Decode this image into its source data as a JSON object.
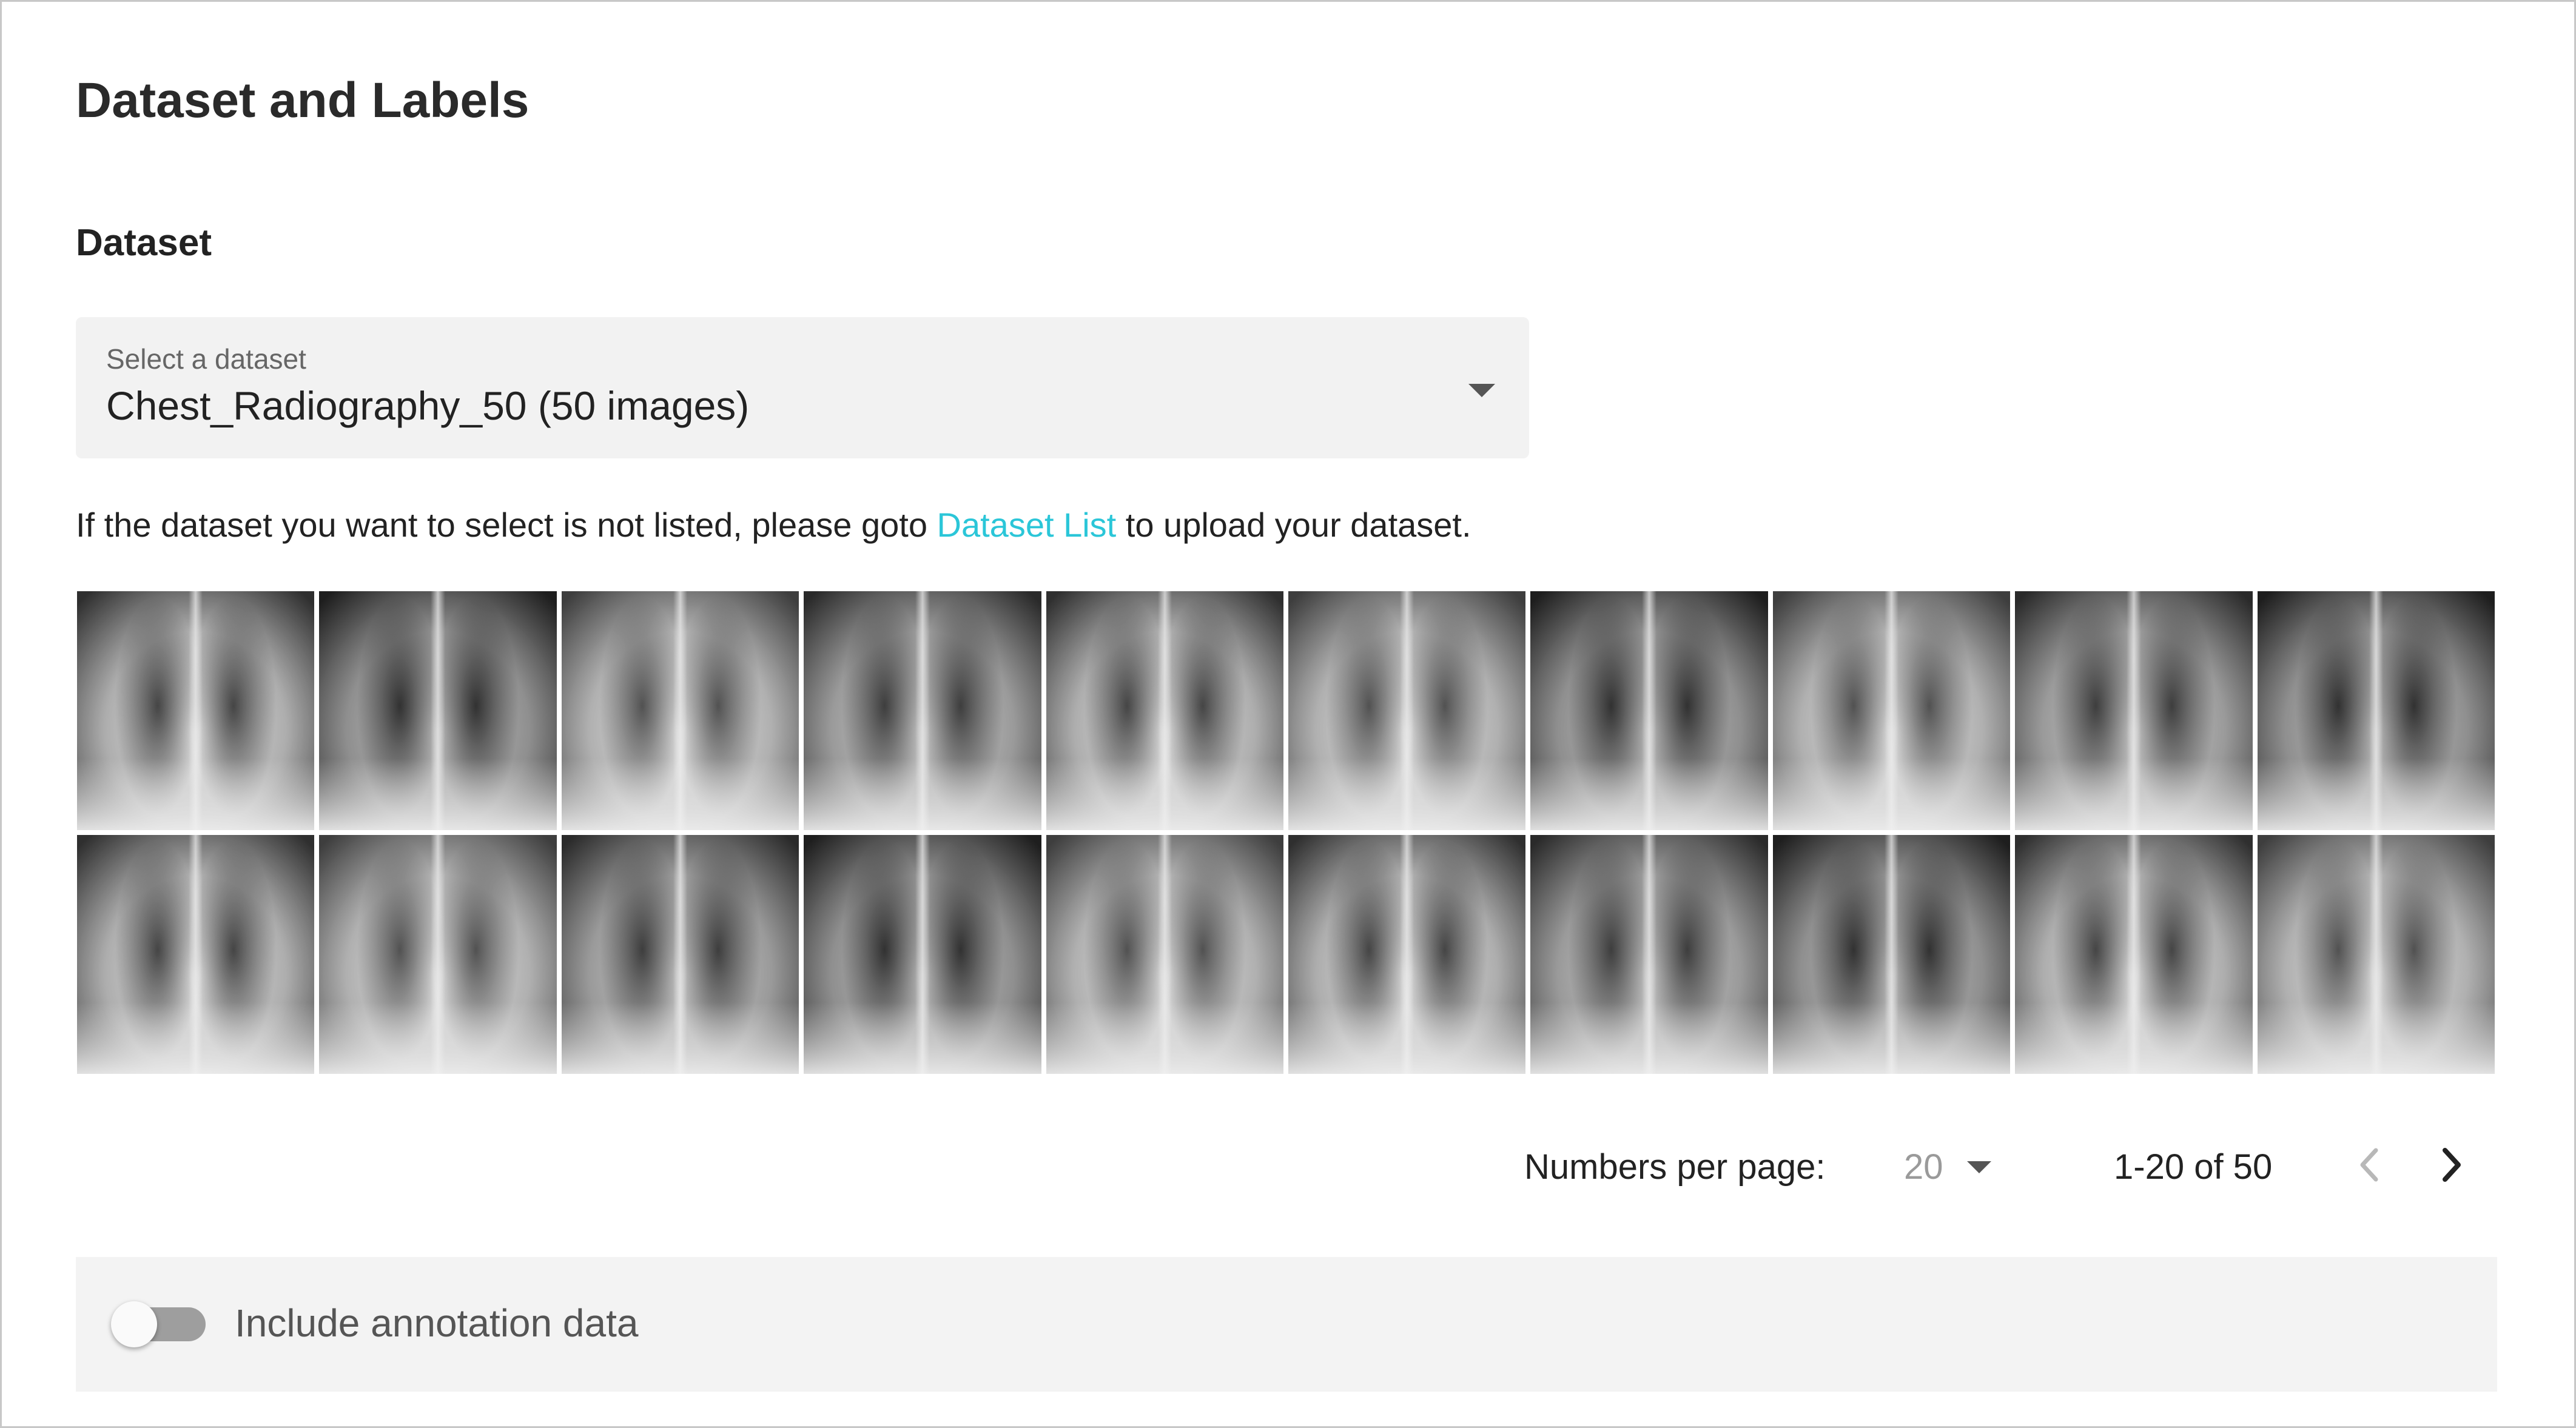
{
  "page": {
    "title": "Dataset and Labels",
    "dataset_heading": "Dataset"
  },
  "dataset_select": {
    "label": "Select a dataset",
    "value": "Chest_Radiography_50 (50 images)"
  },
  "helper": {
    "prefix": "If the dataset you want to select is not listed, please goto ",
    "link_text": "Dataset List",
    "suffix": " to upload your dataset."
  },
  "thumbnails": {
    "count_shown": 20,
    "rows": 2,
    "columns": 10,
    "content": "chest x-ray"
  },
  "pagination": {
    "label": "Numbers per page:",
    "per_page": "20",
    "range": "1-20 of 50",
    "prev_icon": "chevron-left-icon",
    "next_icon": "chevron-right-icon"
  },
  "annotation_toggle": {
    "label": "Include annotation data",
    "enabled": false
  },
  "colors": {
    "link": "#2bc6d8",
    "panel_bg": "#f2f2f2",
    "border": "#c8c8c8"
  }
}
